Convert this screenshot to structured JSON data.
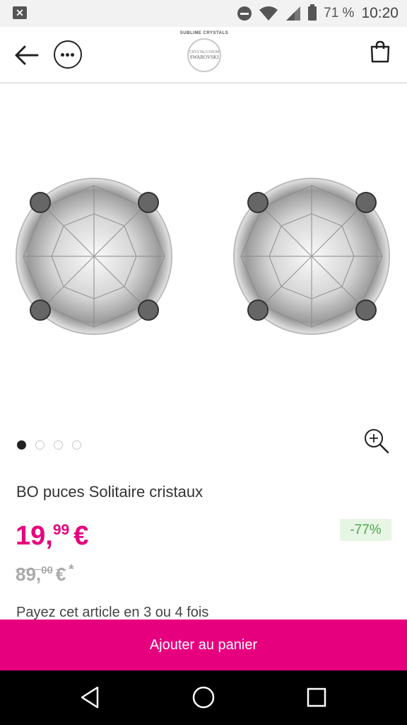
{
  "status_bar": {
    "battery_pct": "71 %",
    "time": "10:20",
    "icons": [
      "notification-icon",
      "do-not-disturb-icon",
      "wifi-icon",
      "signal-icon",
      "battery-icon"
    ]
  },
  "header": {
    "logo_top": "SUBLIME CRYSTALS",
    "logo_seal_small": "CRYSTALS FROM",
    "logo_seal_brand": "SWAROVSKI",
    "icons": [
      "back-arrow-icon",
      "more-options-icon",
      "shopping-bag-icon"
    ]
  },
  "carousel": {
    "total": 4,
    "active": 1
  },
  "product": {
    "title": "BO puces Solitaire cristaux",
    "price_int": "19,",
    "price_dec": "99",
    "price_cur": "€",
    "old_price_int": "89,",
    "old_price_dec": "00",
    "old_price_cur": "€",
    "old_price_mark": "*",
    "discount": "-77%",
    "installment": "Payez cet article en 3 ou 4 fois"
  },
  "cta": {
    "label": "Ajouter au panier"
  },
  "colors": {
    "accent": "#e6007e",
    "discount_bg": "#e7f5e5",
    "discount_text": "#4ca74a"
  }
}
